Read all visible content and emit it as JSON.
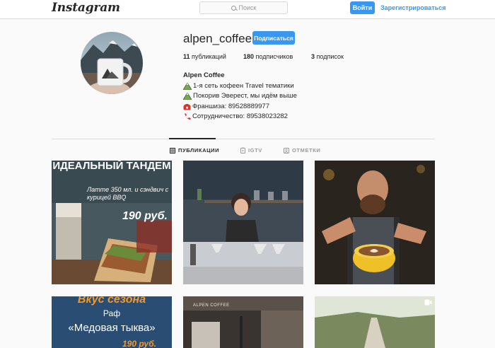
{
  "header": {
    "logo": "Instagram",
    "search_placeholder": "Поиск",
    "login_label": "Войти",
    "signup_label": "Зарегистрироваться"
  },
  "profile": {
    "username": "alpen_coffee",
    "follow_label": "Подписаться",
    "stats": {
      "posts_count": "11",
      "posts_label": "публикаций",
      "followers_count": "180",
      "followers_label": "подписчиков",
      "following_count": "3",
      "following_label": "подписок"
    },
    "bio": {
      "name": "Alpen Coffee",
      "line1": "1-я сеть кофеен Travel тематики",
      "line2": "Покорив Эверест, мы идём выше",
      "line3": "Франшиза: 89528889977",
      "line4": "Сотрудничество: 89538023282"
    }
  },
  "tabs": [
    {
      "label": "ПУБЛИКАЦИИ",
      "icon": "grid-icon",
      "active": true
    },
    {
      "label": "IGTV",
      "icon": "tv-icon",
      "active": false
    },
    {
      "label": "ОТМЕТКИ",
      "icon": "tagged-icon",
      "active": false
    }
  ],
  "posts": {
    "p1": {
      "headline": "ИДЕАЛЬНЫЙ ТАНДЕМ",
      "text": "Латте 350 мл. и сэндвич с курицей BBQ",
      "price": "190 руб."
    },
    "p4": {
      "headline": "Вкус сезона",
      "subtitle": "Раф",
      "name": "«Медовая тыква»",
      "price": "190 руб."
    },
    "p5": {
      "sign": "ALPEN COFFEE"
    }
  },
  "colors": {
    "accent": "#3897f0",
    "border": "#dbdbdb",
    "text": "#262626",
    "background": "#fafafa"
  }
}
